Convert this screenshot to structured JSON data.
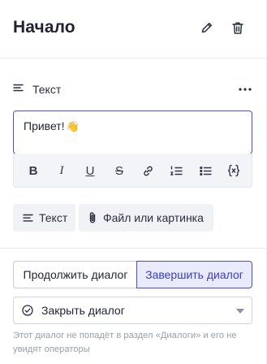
{
  "header": {
    "title": "Начало",
    "edit_icon": "pencil-icon",
    "delete_icon": "trash-icon"
  },
  "block": {
    "type_label": "Текст",
    "type_icon": "text-lines-icon",
    "more_icon": "more-horizontal-icon",
    "message_text": "Привет!",
    "emoji": "👋"
  },
  "toolbar": {
    "items": [
      "bold",
      "italic",
      "underline",
      "strikethrough",
      "link",
      "ordered-list",
      "bullet-list",
      "variable"
    ],
    "bold_label": "B",
    "italic_label": "I",
    "underline_label": "U",
    "strike_label": "S"
  },
  "add_block": {
    "text_label": "Текст",
    "file_label": "Файл или картинка"
  },
  "dialog_action": {
    "continue_label": "Продолжить диалог",
    "finish_label": "Завершить диалог",
    "selected": "finish"
  },
  "close_select": {
    "value": "Закрыть диалог",
    "icon": "check-circle-icon"
  },
  "hint": "Этот диалог не попадёт в раздел «Диалоги» и его не увидят операторы",
  "colors": {
    "accent": "#4c4fc8",
    "accent_bg": "#e9eafb",
    "muted_text": "#9a9eaa"
  }
}
